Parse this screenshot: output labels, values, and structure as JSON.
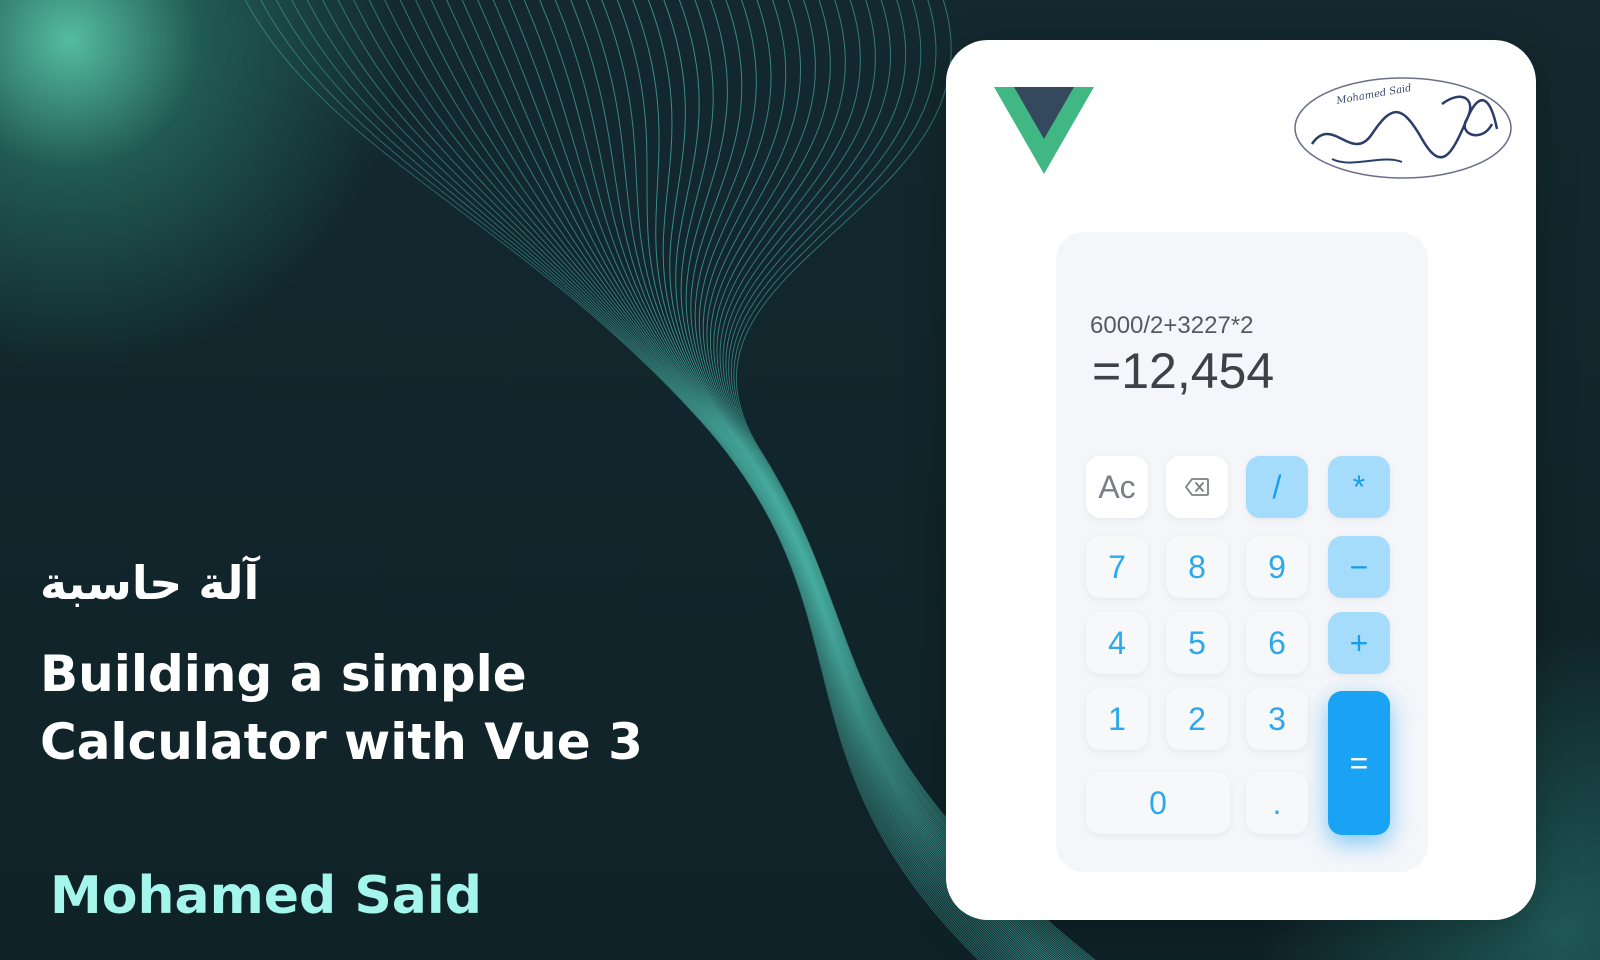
{
  "hero": {
    "arabic_title": "آلة حاسبة",
    "headline_line1": "Building a simple",
    "headline_line2": "Calculator with Vue 3",
    "author": "Mohamed Said"
  },
  "calculator": {
    "expression": "6000/2+3227*2",
    "result": "=12,454",
    "keys": {
      "clear": "Ac",
      "divide": "/",
      "multiply": "*",
      "seven": "7",
      "eight": "8",
      "nine": "9",
      "minus": "−",
      "four": "4",
      "five": "5",
      "six": "6",
      "plus": "+",
      "one": "1",
      "two": "2",
      "three": "3",
      "equals": "=",
      "zero": "0",
      "decimal": "."
    }
  },
  "logos": {
    "vue": "vue-logo",
    "signature_text": "Mohamed Said",
    "signature": "signature-stamp"
  },
  "colors": {
    "accent": "#1aa3f5",
    "operator": "#a5dcfb",
    "digit": "#2da8eb",
    "author": "#a4f5ec",
    "vue_green": "#41b883",
    "vue_dark": "#34495e"
  },
  "icons": {
    "backspace": "backspace-icon"
  }
}
